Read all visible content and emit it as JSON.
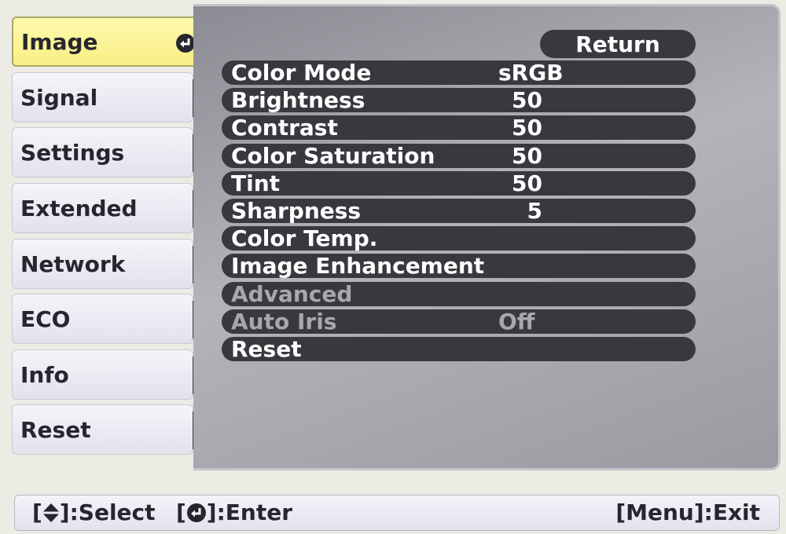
{
  "sidebar": {
    "active_icon": "enter-icon",
    "items": [
      {
        "label": "Image"
      },
      {
        "label": "Signal"
      },
      {
        "label": "Settings"
      },
      {
        "label": "Extended"
      },
      {
        "label": "Network"
      },
      {
        "label": "ECO"
      },
      {
        "label": "Info"
      },
      {
        "label": "Reset"
      }
    ]
  },
  "panel": {
    "return_label": "Return",
    "rows": [
      {
        "label": "Color Mode",
        "value": "sRGB",
        "disabled": false
      },
      {
        "label": "Brightness",
        "value": "50",
        "disabled": false
      },
      {
        "label": "Contrast",
        "value": "50",
        "disabled": false
      },
      {
        "label": "Color Saturation",
        "value": "50",
        "disabled": false
      },
      {
        "label": "Tint",
        "value": "50",
        "disabled": false
      },
      {
        "label": "Sharpness",
        "value": "5",
        "disabled": false
      },
      {
        "label": "Color Temp.",
        "value": "",
        "disabled": false
      },
      {
        "label": "Image Enhancement",
        "value": "",
        "disabled": false
      },
      {
        "label": "Advanced",
        "value": "",
        "disabled": true
      },
      {
        "label": "Auto Iris",
        "value": "Off",
        "disabled": true
      },
      {
        "label": "Reset",
        "value": "",
        "disabled": false
      }
    ]
  },
  "footer": {
    "select_open": "[",
    "select_text": "]:Select",
    "enter_open": "[",
    "enter_text": "]:Enter",
    "exit_text": "[Menu]:Exit"
  },
  "colors": {
    "active_tab": "#f8ef84",
    "row_background": "#38383f",
    "panel_background": "#a9a8af",
    "disabled_text": "#a8a7ad"
  }
}
